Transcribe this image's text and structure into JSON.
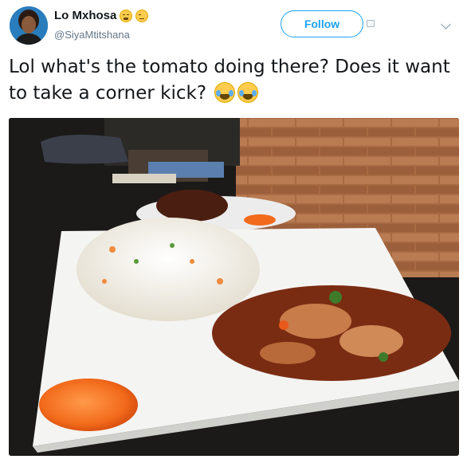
{
  "user": {
    "name": "Lo Mxhosa",
    "handle": "@SiyaMtitshana",
    "name_emojis": [
      "weary-face-emoji",
      "unamused-face-emoji"
    ]
  },
  "actions": {
    "follow_label": "Follow"
  },
  "tweet": {
    "text": "Lol what's the tomato doing there? Does it want to take a corner kick?",
    "trailing_emojis": [
      "face-with-tears-of-joy-emoji",
      "face-with-tears-of-joy-emoji"
    ]
  },
  "colors": {
    "accent": "#1da1f2",
    "name": "#14171a",
    "handle": "#657786",
    "photo_background": "#1b1a18",
    "plate": "#f4f4f2",
    "tomato": "#f26a1b",
    "brick_wall": "#a86a43"
  },
  "icons": {
    "caret": "chevron-down-icon",
    "side": "placeholder-icon"
  }
}
